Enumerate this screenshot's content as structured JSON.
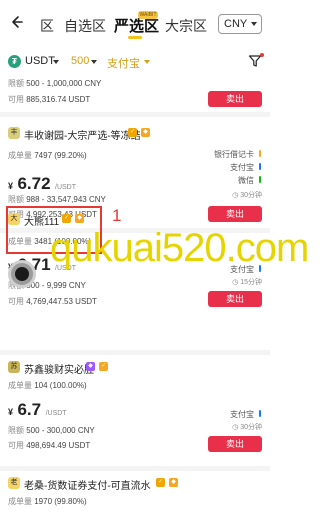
{
  "nav": {
    "back_icon": "arrow-left-icon",
    "tabs": [
      {
        "label": "区"
      },
      {
        "label": "自选区"
      },
      {
        "label": "严选区"
      },
      {
        "label": "大宗区"
      }
    ],
    "active_badge": "WAIBIT",
    "currency": "CNY"
  },
  "filters": {
    "coin": "USDT",
    "amount": "500",
    "payment": "支付宝",
    "filter_icon": "funnel-icon"
  },
  "listings": [
    {
      "limit_label": "限额",
      "limit_value": "500 - 1,000,000 CNY",
      "available_label": "可用",
      "available_value": "885,316.74 USDT",
      "sell_label": "卖出"
    },
    {
      "avatar": "丰",
      "merchant": "丰收谢园-大宗严选-等冻结",
      "trades_label": "成单量",
      "trades_value": "7497 (99.20%)",
      "currency_symbol": "¥",
      "price": "6.72",
      "price_unit": "/USDT",
      "limit_label": "限额",
      "limit_value": "988 - 33,547,943 CNY",
      "available_label": "可用",
      "available_value": "4,992,253.43 USDT",
      "payments": [
        "银行借记卡",
        "支付宝",
        "微信"
      ],
      "time": "30分钟",
      "sell_label": "卖出"
    },
    {
      "avatar": "大",
      "merchant": "大熊111",
      "trades_label": "成单量",
      "trades_value": "3481 (100.00%)",
      "currency_symbol": "¥",
      "price": "6.71",
      "price_unit": "/USDT",
      "limit_label": "限额",
      "limit_value": "500 - 9,999 CNY",
      "available_label": "可用",
      "available_value": "4,769,447.53 USDT",
      "payments": [
        "支付宝"
      ],
      "time": "15分钟",
      "sell_label": "卖出"
    },
    {
      "avatar": "苏",
      "merchant": "苏鑫骏财实必胜",
      "trades_label": "成单量",
      "trades_value": "104 (100.00%)",
      "currency_symbol": "¥",
      "price": "6.7",
      "price_unit": "/USDT",
      "limit_label": "限额",
      "limit_value": "500 - 300,000 CNY",
      "available_label": "可用",
      "available_value": "498,694.49 USDT",
      "payments": [
        "支付宝"
      ],
      "time": "30分钟",
      "sell_label": "卖出"
    },
    {
      "avatar": "老",
      "merchant": "老桑-货数证券支付-可直流水",
      "trades_label": "成单量",
      "trades_value": "1970 (99.80%)"
    }
  ],
  "annotation": {
    "number": "1",
    "watermark": "qukuai520.com"
  },
  "colors": {
    "sell": "#e8304b",
    "accent": "#f0c419",
    "alipay": "#1677ff",
    "wechat": "#09bb07",
    "bank": "#f5a623",
    "highlight": "#e53935"
  }
}
